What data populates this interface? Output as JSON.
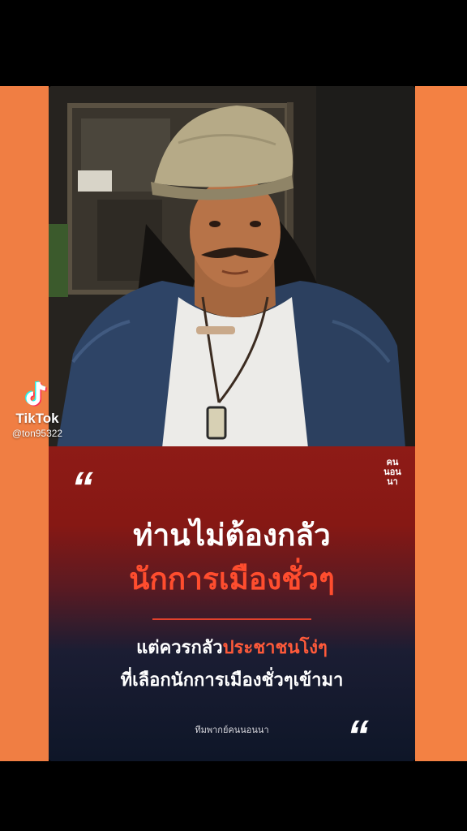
{
  "watermark": {
    "app_name": "TikTok",
    "username": "@ton95322"
  },
  "post": {
    "brand_badge_lines": [
      "คน",
      "นอน",
      "นา"
    ],
    "quote_mark": "“",
    "headline_line1": "ท่านไม่ต้องกลัว",
    "headline_line2": "นักการเมืองชั่วๆ",
    "sub_line1_prefix": "แต่ควรกลัว",
    "sub_line1_highlight": "ประชาชนโง่ๆ",
    "sub_line2": "ที่เลือกนักการเมืองชั่วๆเข้ามา",
    "credit": "ทีมพากย์คนนอนนา"
  },
  "colors": {
    "frame_orange": "#f07e43",
    "headline_red": "#ff4d2e",
    "panel_red": "#8e1b16",
    "panel_navy": "#0e1628"
  },
  "icons": [
    "tiktok-logo-icon",
    "quote-open-icon",
    "quote-close-icon"
  ]
}
